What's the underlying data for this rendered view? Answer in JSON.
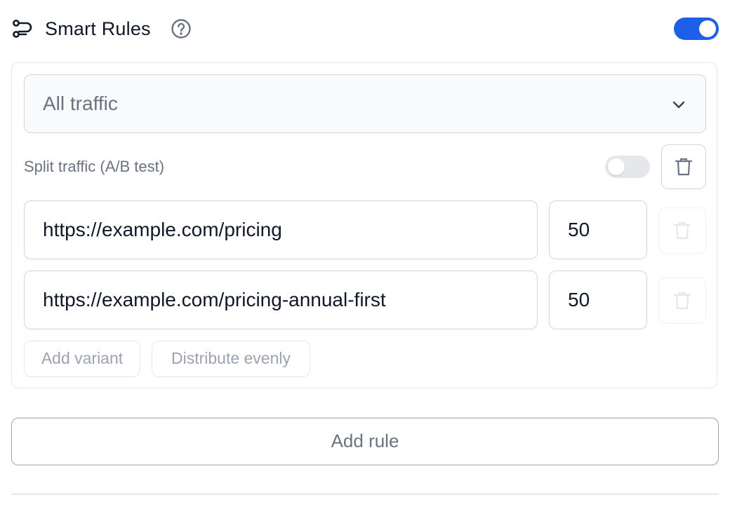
{
  "header": {
    "title": "Smart Rules",
    "icon": "rules-icon",
    "help_icon": "help-icon",
    "enabled": true,
    "accent_color": "#1d5fe8"
  },
  "rule": {
    "traffic_select": {
      "selected": "All traffic",
      "icon": "chevron-down-icon"
    },
    "split": {
      "label": "Split traffic (A/B test)",
      "enabled": false
    },
    "variants": [
      {
        "url": "https://example.com/pricing",
        "weight": "50"
      },
      {
        "url": "https://example.com/pricing-annual-first",
        "weight": "50"
      }
    ],
    "add_variant_label": "Add variant",
    "distribute_label": "Distribute evenly"
  },
  "add_rule_label": "Add rule"
}
